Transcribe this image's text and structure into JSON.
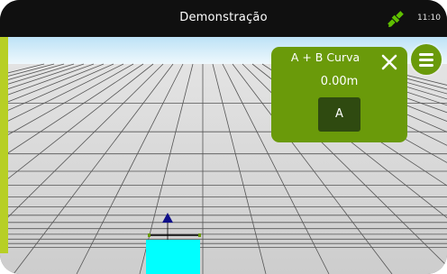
{
  "statusbar": {
    "title": "Demonstração",
    "time": "11:10",
    "satellite_icon": "satellite-icon",
    "colors": {
      "background": "#101010",
      "satellite": "#5fbf00"
    }
  },
  "panel": {
    "title": "A + B Curva",
    "distance": "0.00m",
    "a_button_label": "A",
    "close_icon": "close-icon",
    "colors": {
      "background": "#6a9a0a",
      "button": "#2f4a10"
    }
  },
  "menu_button": {
    "icon": "hamburger-menu-icon"
  },
  "scene": {
    "colors": {
      "sky": "#c9e8f8",
      "ground": "#d9d9d9",
      "grid": "#505050",
      "vehicle": "#00ffff",
      "arrow": "#10108a",
      "accent_stripe": "#b7cf25"
    }
  }
}
